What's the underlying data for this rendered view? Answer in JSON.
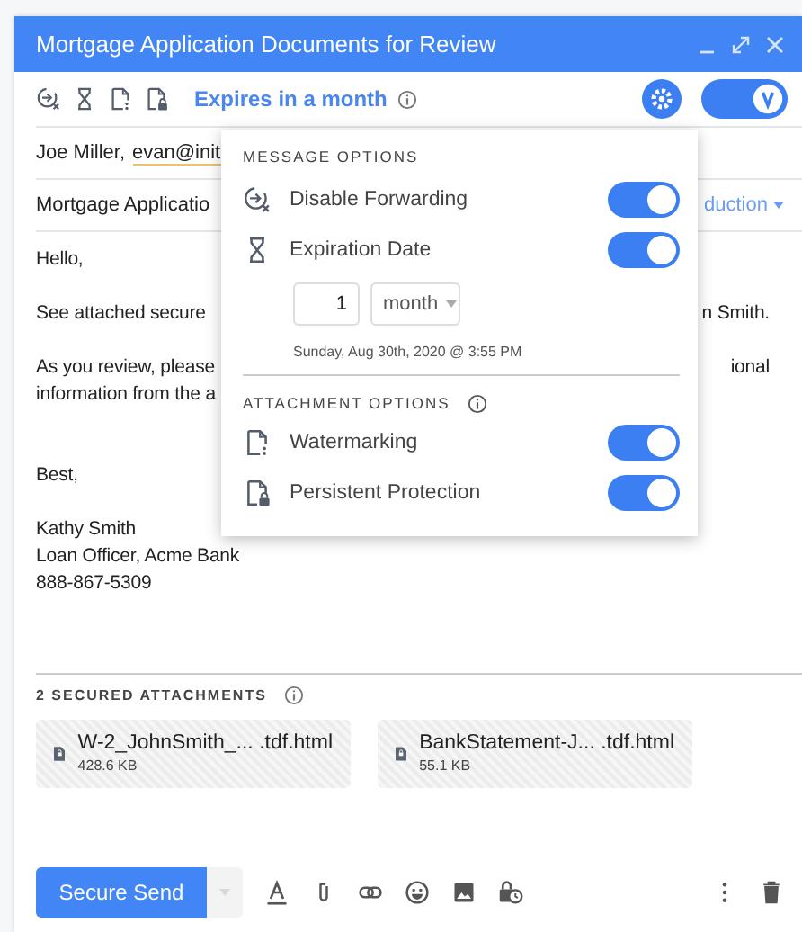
{
  "window": {
    "title": "Mortgage Application Documents for Review"
  },
  "toolbar": {
    "icons": [
      {
        "kind": "forwarding"
      },
      {
        "kind": "expiration"
      },
      {
        "kind": "watermark"
      },
      {
        "kind": "protection"
      }
    ],
    "expires": "Expires in a month",
    "secure_mode": {
      "on": true
    }
  },
  "recipients": {
    "names": "Joe Miller,",
    "email": "evan@init"
  },
  "subject": {
    "text": "Mortgage Applicatio",
    "template": "duction"
  },
  "body": [
    {
      "lines": [
        {
          "left": "Hello,"
        }
      ]
    },
    {
      "lines": [
        {
          "left": "See attached secure",
          "right": "n Smith."
        }
      ]
    },
    {
      "lines": [
        {
          "left": "As you review, please",
          "right": "ional"
        },
        {
          "left": "information from the a"
        }
      ]
    },
    {
      "lines": [
        {
          "left": "Best,"
        }
      ]
    },
    {
      "lines": [
        {
          "left": "Kathy Smith"
        },
        {
          "left": "Loan Officer, Acme Bank"
        },
        {
          "left": "888-867-5309"
        }
      ]
    }
  ],
  "options_menu": {
    "message_heading": "MESSAGE OPTIONS",
    "message_options": [
      {
        "kind": "forwarding",
        "label": "Disable Forwarding",
        "on": true
      },
      {
        "kind": "expiration",
        "label": "Expiration Date",
        "on": true
      }
    ],
    "expiration": {
      "count": "1",
      "unit": "month",
      "date": "Sunday, Aug 30th, 2020 @ 3:55 PM"
    },
    "attachment_heading": "ATTACHMENT OPTIONS",
    "attachment_options": [
      {
        "kind": "watermark",
        "label": "Watermarking",
        "on": true
      },
      {
        "kind": "protection",
        "label": "Persistent Protection",
        "on": true
      }
    ]
  },
  "attachments": {
    "heading": "2 SECURED ATTACHMENTS",
    "files": [
      {
        "name": "W-2_JohnSmith_...",
        "ext": ".tdf.html",
        "size": "428.6 KB"
      },
      {
        "name": "BankStatement-J...",
        "ext": ".tdf.html",
        "size": "55.1 KB"
      }
    ]
  },
  "footer": {
    "send": "Secure Send"
  }
}
